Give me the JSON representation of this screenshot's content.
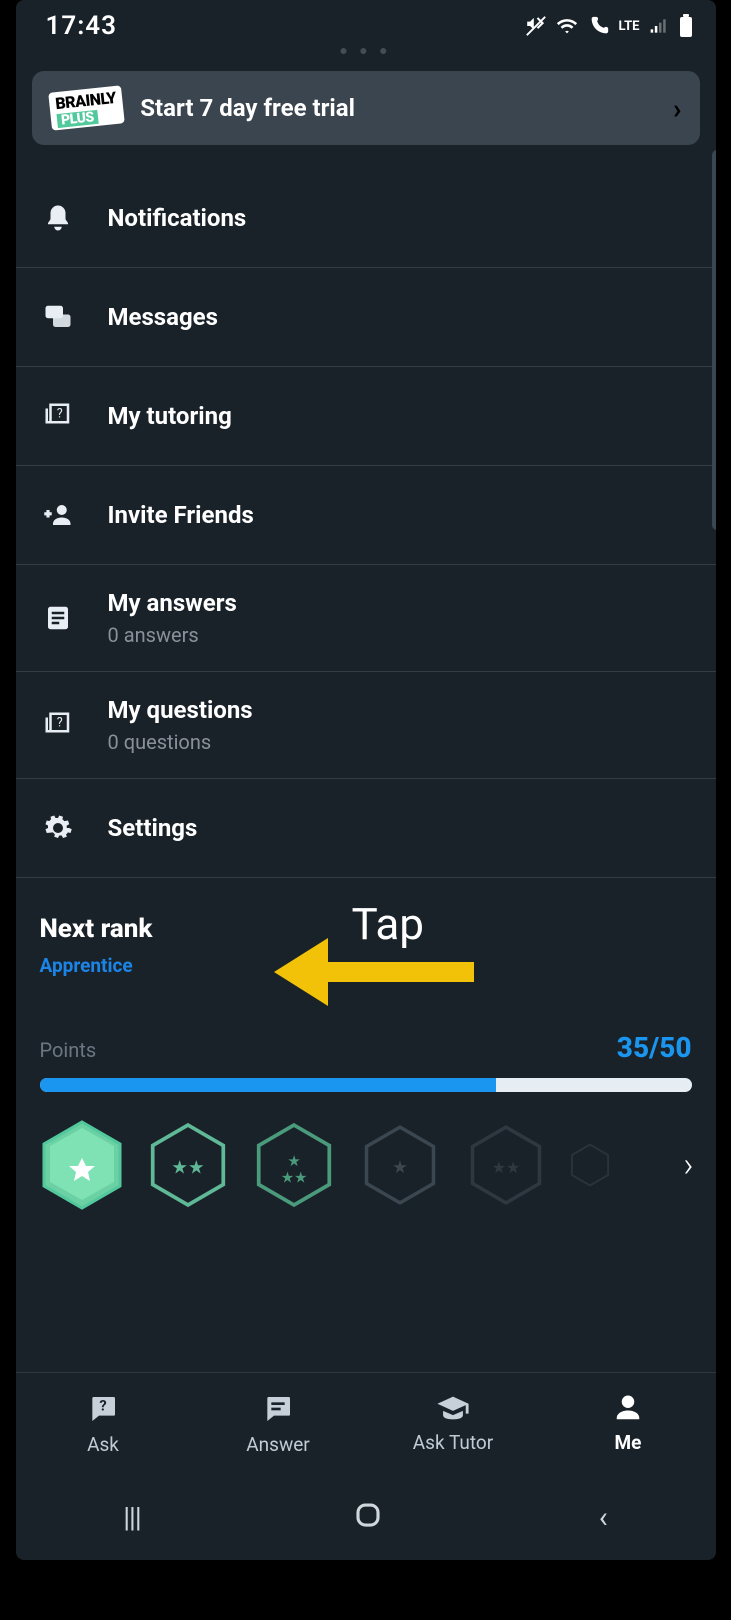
{
  "status": {
    "time": "17:43",
    "network": "LTE"
  },
  "promo": {
    "badge_line1": "BRAINLY",
    "badge_line2": "PLUS",
    "text": "Start 7 day free trial"
  },
  "menu": {
    "notifications": {
      "label": "Notifications"
    },
    "messages": {
      "label": "Messages"
    },
    "tutoring": {
      "label": "My tutoring"
    },
    "invite": {
      "label": "Invite Friends"
    },
    "answers": {
      "label": "My answers",
      "sub": "0 answers"
    },
    "questions": {
      "label": "My questions",
      "sub": "0 questions"
    },
    "settings": {
      "label": "Settings"
    }
  },
  "rank": {
    "heading": "Next rank",
    "name": "Apprentice",
    "points_label": "Points",
    "points_value": "35/50",
    "progress_pct": 70
  },
  "nav": {
    "ask": "Ask",
    "answer": "Answer",
    "asktutor": "Ask Tutor",
    "me": "Me"
  },
  "annotation": {
    "text": "Tap"
  }
}
